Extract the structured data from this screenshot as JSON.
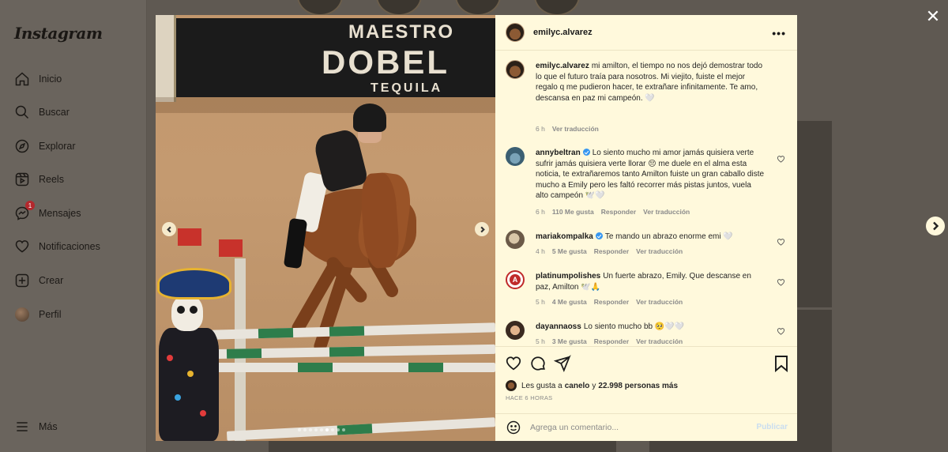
{
  "sidebar": {
    "logo": "Instagram",
    "items": [
      {
        "label": "Inicio",
        "icon": "home-icon"
      },
      {
        "label": "Buscar",
        "icon": "search-icon"
      },
      {
        "label": "Explorar",
        "icon": "compass-icon"
      },
      {
        "label": "Reels",
        "icon": "reels-icon"
      },
      {
        "label": "Mensajes",
        "icon": "messenger-icon",
        "badge": "1"
      },
      {
        "label": "Notificaciones",
        "icon": "heart-icon"
      },
      {
        "label": "Crear",
        "icon": "plus-square-icon"
      },
      {
        "label": "Perfil",
        "icon": "avatar"
      }
    ],
    "more_label": "Más"
  },
  "post": {
    "owner": "emilyc.alvarez",
    "media": {
      "banner_line1": "MAESTRO",
      "banner_line2": "DOBEL",
      "banner_line3": "TEQUILA",
      "slide_count": 9,
      "active_slide": 5
    },
    "caption": {
      "user": "emilyc.alvarez",
      "text": "mi amilton, el tiempo no nos dejó demostrar todo lo que el futuro traía para nosotros. Mi viejito, fuiste el mejor regalo q me pudieron hacer, te extrañare infinitamente. Te amo, descansa en paz mi campeón. 🤍",
      "time": "6 h",
      "translate": "Ver traducción"
    },
    "comments": [
      {
        "user": "annybeltran",
        "verified": true,
        "text": "Lo siento mucho mi amor jamás quisiera verte sufrir jamás quisiera verte llorar 😔 me duele en el alma esta noticia, te extrañaremos tanto Amilton fuiste un gran caballo diste mucho a Emily pero les faltó recorrer más pistas juntos, vuela alto campeón 🕊️🤍",
        "time": "6 h",
        "likes": "110 Me gusta",
        "reply": "Responder",
        "translate": "Ver traducción"
      },
      {
        "user": "mariakompalka",
        "verified": true,
        "text": "Te mando un abrazo enorme emi 🤍",
        "time": "4 h",
        "likes": "5 Me gusta",
        "reply": "Responder",
        "translate": "Ver traducción"
      },
      {
        "user": "platinumpolishes",
        "verified": false,
        "text": "Un fuerte abrazo, Emily. Que descanse en paz, Amilton 🕊️🙏",
        "time": "5 h",
        "likes": "4 Me gusta",
        "reply": "Responder",
        "translate": "Ver traducción"
      },
      {
        "user": "dayannaoss",
        "verified": false,
        "text": "Lo siento mucho bb 🥺🤍🤍",
        "time": "5 h",
        "likes": "3 Me gusta",
        "reply": "Responder",
        "translate": "Ver traducción"
      }
    ],
    "likes_summary": {
      "prefix": "Les gusta a",
      "user": "canelo",
      "middle": "y",
      "count": "22.998 personas más"
    },
    "time_ago": "HACE 6 HORAS",
    "comment_placeholder": "Agrega un comentario...",
    "publish_label": "Publicar"
  },
  "colors": {
    "panel_bg": "#fff9dc",
    "overlay": "#5c5650",
    "verified": "#3797f0",
    "publish_disabled": "#c9ddf0"
  }
}
